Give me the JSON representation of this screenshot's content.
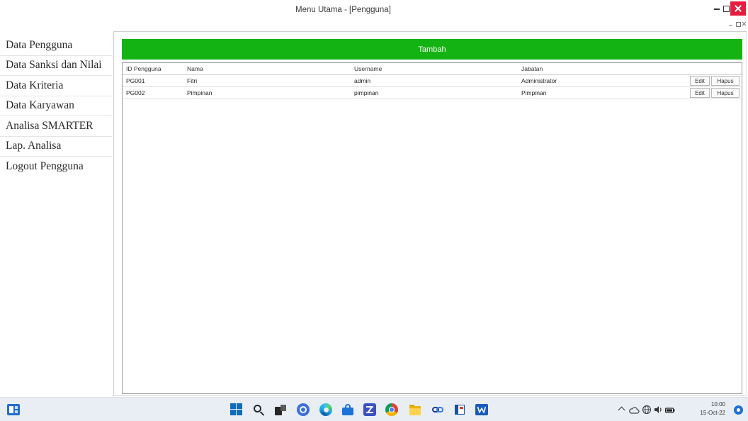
{
  "window": {
    "title": "Menu Utama - [Pengguna]",
    "controls": [
      "minimize-icon",
      "maximize-icon",
      "close-icon"
    ],
    "mdi_controls": [
      "mdi-minimize-icon",
      "mdi-restore-icon",
      "mdi-close-icon"
    ]
  },
  "sidebar": {
    "items": [
      {
        "label": "Data Pengguna"
      },
      {
        "label": "Data Sanksi dan Nilai"
      },
      {
        "label": "Data Kriteria"
      },
      {
        "label": "Data Karyawan"
      },
      {
        "label": "Analisa SMARTER"
      },
      {
        "label": "Lap. Analisa"
      },
      {
        "label": "Logout Pengguna"
      }
    ]
  },
  "main": {
    "add_button_label": "Tambah",
    "table": {
      "columns": [
        "ID Pengguna",
        "Nama",
        "Username",
        "Jabatan"
      ],
      "rows": [
        {
          "id": "PG001",
          "nama": "Fitri",
          "username": "admin",
          "jabatan": "Administrator",
          "edit_label": "Edit",
          "delete_label": "Hapus"
        },
        {
          "id": "PG002",
          "nama": "Pimpinan",
          "username": "pimpinan",
          "jabatan": "Pimpinan",
          "edit_label": "Edit",
          "delete_label": "Hapus"
        }
      ]
    }
  },
  "taskbar": {
    "left_icon": "widgets-icon",
    "icons": [
      "windows-start-icon",
      "search-icon",
      "task-view-icon",
      "chat-icon",
      "edge-browser-icon",
      "store-icon",
      "blue-app-icon",
      "chrome-icon",
      "file-explorer-icon",
      "link-app-icon",
      "window-app-icon",
      "word-icon"
    ],
    "tray_icons": [
      "chevron-up-icon",
      "onedrive-cloud-icon",
      "network-icon",
      "speaker-icon",
      "battery-icon",
      "notification-icon"
    ],
    "time": "10:00",
    "date": "15-Oct-22"
  },
  "colors": {
    "accent_green": "#13b313",
    "close_red": "#e81c3d",
    "taskbar_bg": "#e9eef5",
    "windows_blue": "#0f6cbd"
  }
}
